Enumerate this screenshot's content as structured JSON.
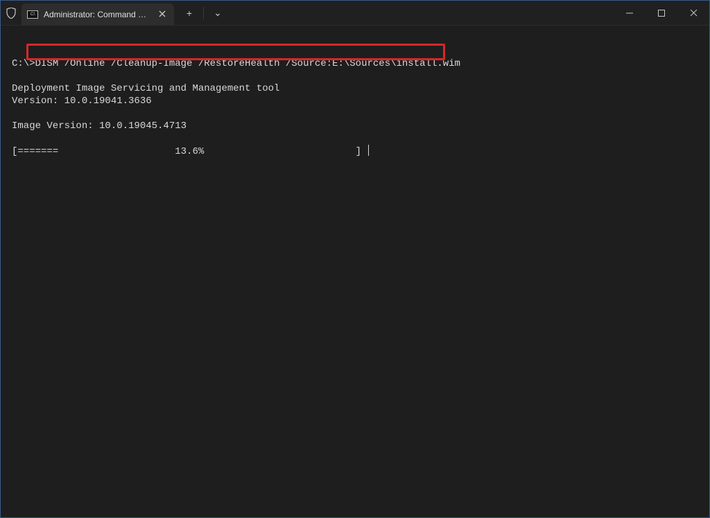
{
  "titlebar": {
    "tab": {
      "icon_text": "C:\\",
      "title": "Administrator: Command Prompt"
    },
    "new_tab_label": "+",
    "dropdown_label": "⌄"
  },
  "terminal": {
    "prompt": "C:\\>",
    "command": "DISM /Online /Cleanup-Image /RestoreHealth /Source:E:\\Sources\\install.wim",
    "output": {
      "tool_line": "Deployment Image Servicing and Management tool",
      "version_line": "Version: 10.0.19041.3636",
      "image_version_line": "Image Version: 10.0.19045.4713",
      "progress_line": "[=======                    13.6%                          ] "
    }
  },
  "annotation": {
    "highlight_color": "#d62828"
  }
}
